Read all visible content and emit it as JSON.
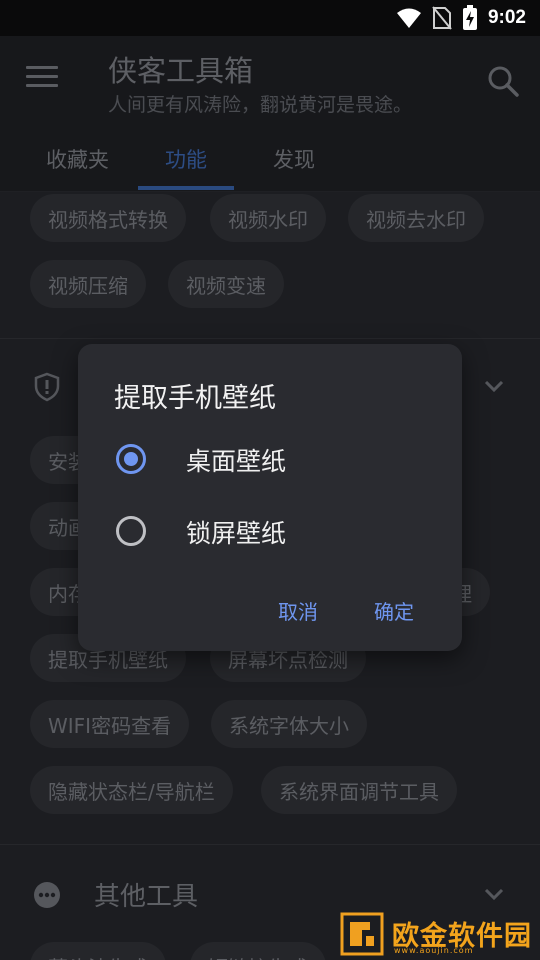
{
  "status_bar": {
    "time": "9:02"
  },
  "app_bar": {
    "title": "侠客工具箱",
    "subtitle": "人间更有风涛险，翻说黄河是畏途。"
  },
  "tabs": [
    {
      "label": "收藏夹",
      "active": false
    },
    {
      "label": "功能",
      "active": true
    },
    {
      "label": "发现",
      "active": false
    }
  ],
  "video_chips": [
    "视频格式转换",
    "视频水印",
    "视频去水印",
    "视频压缩",
    "视频变速"
  ],
  "system_section": {
    "partial_chips": [
      "安装",
      "动画",
      "内存",
      "理"
    ],
    "chips": [
      "提取手机壁纸",
      "屏幕坏点检测",
      "WIFI密码查看",
      "系统字体大小",
      "隐藏状态栏/导航栏",
      "系统界面调节工具"
    ]
  },
  "other_section": {
    "title": "其他工具",
    "partial_chips": [
      "蒿头法生成",
      "短链接生成"
    ]
  },
  "dialog": {
    "title": "提取手机壁纸",
    "options": [
      {
        "label": "桌面壁纸",
        "selected": true
      },
      {
        "label": "锁屏壁纸",
        "selected": false
      }
    ],
    "cancel_label": "取消",
    "confirm_label": "确定"
  },
  "watermark": {
    "text": "欧金软件园",
    "url": "www.aoujin.com"
  },
  "colors": {
    "accent": "#6f96f0",
    "tab_active": "#2d4d85",
    "watermark": "#f3a41c"
  }
}
